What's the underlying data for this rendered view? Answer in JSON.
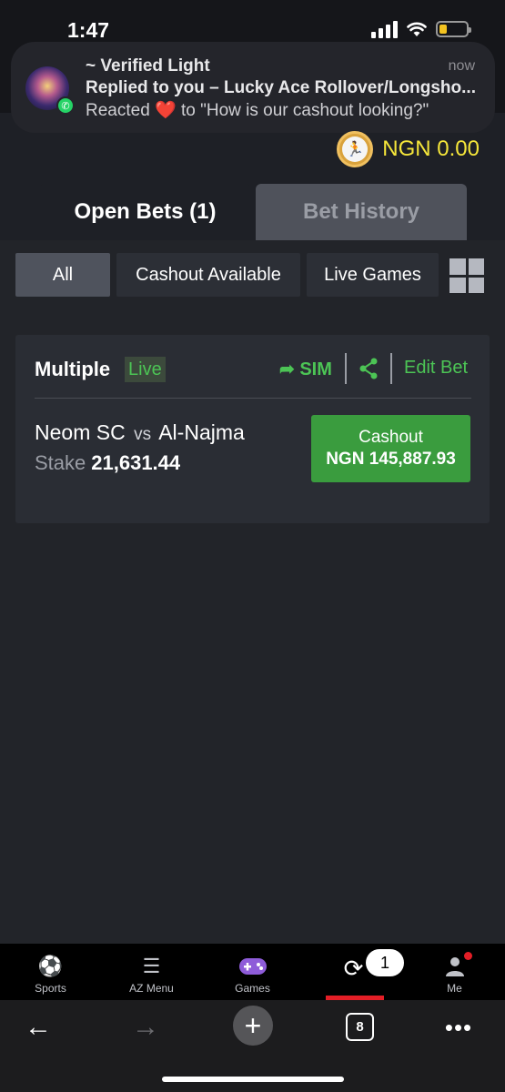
{
  "status_bar": {
    "time": "1:47"
  },
  "notification": {
    "app_icon": "whatsapp-icon",
    "sender": "~ Verified Light",
    "time": "now",
    "line1": "Replied to you – Lucky Ace Rollover/Longsho...",
    "line2_pre": "Reacted ",
    "heart": "❤️",
    "line2_post": " to \"How is our cashout looking?\""
  },
  "balance": {
    "text": "NGN 0.00"
  },
  "tabs": [
    {
      "label": "Open Bets (1)",
      "active": true
    },
    {
      "label": "Bet History",
      "active": false
    }
  ],
  "filters": [
    {
      "label": "All",
      "active": true
    },
    {
      "label": "Cashout Available",
      "active": false
    },
    {
      "label": "Live Games",
      "active": false
    }
  ],
  "bet": {
    "type": "Multiple",
    "live_label": "Live",
    "sim_label": "SIM",
    "edit_label": "Edit Bet",
    "home_team": "Neom SC",
    "vs": "vs",
    "away_team": "Al-Najma",
    "stake_label": "Stake",
    "stake_value": "21,631.44",
    "cashout_label": "Cashout",
    "cashout_amount": "NGN 145,887.93"
  },
  "bottom_nav": [
    {
      "label": "Sports",
      "icon": "football-icon"
    },
    {
      "label": "AZ Menu",
      "icon": "menu-icon"
    },
    {
      "label": "Games",
      "icon": "gamepad-icon"
    },
    {
      "label": "",
      "icon": "betslip-icon",
      "active": true
    },
    {
      "label": "Me",
      "icon": "user-icon"
    }
  ],
  "betslip_count": "1",
  "browser": {
    "tab_count": "8"
  },
  "colors": {
    "accent_green": "#4cc455",
    "cashout_green": "#3a9c3e",
    "balance_yellow": "#f5e63a",
    "active_red": "#e31e26"
  }
}
